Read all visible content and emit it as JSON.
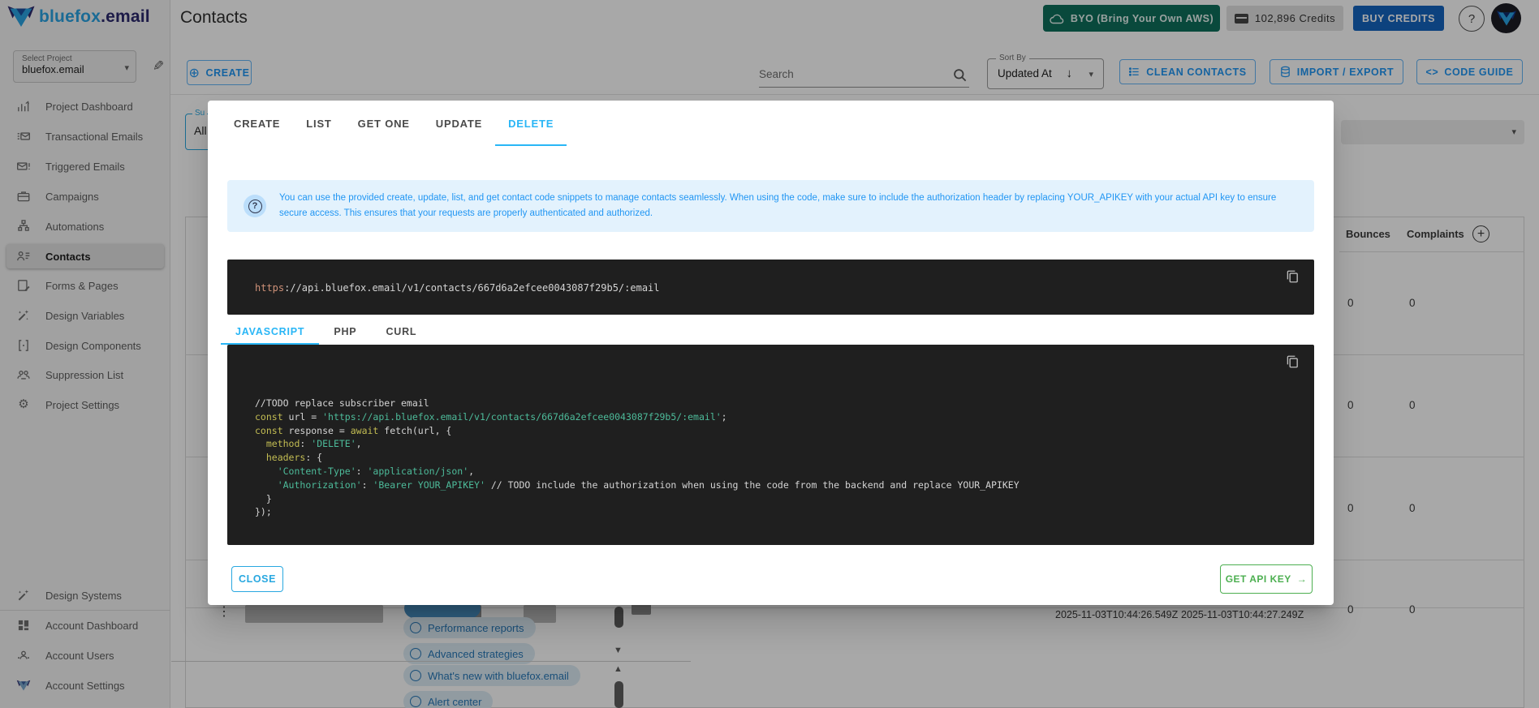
{
  "brand": {
    "word_primary": "bluefox",
    "word_secondary": ".email"
  },
  "topbar": {
    "title": "Contacts",
    "byo_label": "BYO (Bring Your Own AWS)",
    "credits_label": "102,896 Credits",
    "buy_credits_label": "BUY CREDITS",
    "help_label": "?"
  },
  "project_select": {
    "label": "Select Project",
    "value": "bluefox.email"
  },
  "sidebar": {
    "items": [
      {
        "label": "Project Dashboard",
        "icon": "dashboard-icon",
        "active": false
      },
      {
        "label": "Transactional Emails",
        "icon": "transactional-emails-icon",
        "active": false
      },
      {
        "label": "Triggered Emails",
        "icon": "triggered-emails-icon",
        "active": false
      },
      {
        "label": "Campaigns",
        "icon": "campaigns-icon",
        "active": false
      },
      {
        "label": "Automations",
        "icon": "automations-icon",
        "active": false
      },
      {
        "label": "Contacts",
        "icon": "contacts-icon",
        "active": true
      },
      {
        "label": "Forms & Pages",
        "icon": "forms-pages-icon",
        "active": false
      },
      {
        "label": "Design Variables",
        "icon": "design-variables-icon",
        "active": false
      },
      {
        "label": "Design Components",
        "icon": "design-components-icon",
        "active": false
      },
      {
        "label": "Suppression List",
        "icon": "suppression-list-icon",
        "active": false
      },
      {
        "label": "Project Settings",
        "icon": "project-settings-icon",
        "active": false
      }
    ],
    "bottom_items": [
      {
        "label": "Design Systems",
        "icon": "design-systems-icon"
      },
      {
        "label": "Account Dashboard",
        "icon": "account-dashboard-icon"
      },
      {
        "label": "Account Users",
        "icon": "account-users-icon"
      },
      {
        "label": "Account Settings",
        "icon": "account-settings-icon"
      }
    ]
  },
  "toolbar": {
    "create_label": "CREATE",
    "search_placeholder": "Search",
    "sort_label": "Sort By",
    "sort_value": "Updated At",
    "clean_label": "CLEAN CONTACTS",
    "import_export_label": "IMPORT / EXPORT",
    "code_guide_label": "CODE GUIDE"
  },
  "background": {
    "left_filter": {
      "label": "Su",
      "value": "All"
    },
    "table": {
      "headers": [
        "Bounces",
        "Complaints"
      ],
      "zero_rows": [
        [
          "0",
          "0"
        ],
        [
          "0",
          "0"
        ],
        [
          "0",
          "0"
        ],
        [
          "0",
          "0"
        ]
      ],
      "dates": [
        "2025-11-03T10:44:26.549Z",
        "2025-11-03T10:44:27.249Z"
      ]
    },
    "dropdown_chips": [
      "Performance reports",
      "Advanced strategies",
      "What's new with bluefox.email",
      "Alert center"
    ]
  },
  "modal": {
    "tabs": [
      "CREATE",
      "LIST",
      "GET ONE",
      "UPDATE",
      "DELETE"
    ],
    "active_tab": "DELETE",
    "info_text": "You can use the provided create, update, list, and get contact code snippets to manage contacts seamlessly. When using the code, make sure to include the authorization header by replacing YOUR_APIKEY with your actual API key to ensure secure access. This ensures that your requests are properly authenticated and authorized.",
    "endpoint": {
      "scheme": "https",
      "rest": "://api.bluefox.email/v1/contacts/667d6a2efcee0043087f29b5/:email"
    },
    "lang_tabs": [
      "JAVASCRIPT",
      "PHP",
      "CURL"
    ],
    "active_lang": "JAVASCRIPT",
    "code_lines": [
      [
        [
          "p",
          "//TODO replace subscriber email"
        ]
      ],
      [
        [
          "k",
          "const"
        ],
        [
          "p",
          " url = "
        ],
        [
          "s",
          "'https://api.bluefox.email/v1/contacts/667d6a2efcee0043087f29b5/:email'"
        ],
        [
          "p",
          ";"
        ]
      ],
      [
        [
          "k",
          "const"
        ],
        [
          "p",
          " response = "
        ],
        [
          "k",
          "await"
        ],
        [
          "p",
          " fetch(url, {"
        ]
      ],
      [
        [
          "p",
          "  "
        ],
        [
          "k",
          "method"
        ],
        [
          "p",
          ": "
        ],
        [
          "s",
          "'DELETE'"
        ],
        [
          "p",
          ","
        ]
      ],
      [
        [
          "p",
          "  "
        ],
        [
          "k",
          "headers"
        ],
        [
          "p",
          ": {"
        ]
      ],
      [
        [
          "p",
          "    "
        ],
        [
          "s",
          "'Content-Type'"
        ],
        [
          "p",
          ": "
        ],
        [
          "s",
          "'application/json'"
        ],
        [
          "p",
          ","
        ]
      ],
      [
        [
          "p",
          "    "
        ],
        [
          "s",
          "'Authorization'"
        ],
        [
          "p",
          ": "
        ],
        [
          "s",
          "'Bearer YOUR_APIKEY'"
        ],
        [
          "p",
          " // TODO include the authorization when using the code from the backend and replace YOUR_APIKEY"
        ]
      ],
      [
        [
          "p",
          "  }"
        ]
      ],
      [
        [
          "p",
          "});"
        ]
      ]
    ],
    "close_label": "CLOSE",
    "get_api_key_label": "GET API KEY"
  },
  "colors": {
    "accent_cyan": "#29b6f6",
    "toolbar_blue": "#2196f3",
    "byo_teal": "#0e6f5c",
    "buy_blue": "#1565c0",
    "get_key_green": "#4caf50",
    "code_bg": "#1f1f1f",
    "code_keyword": "#c3bd53",
    "code_string": "#4dbb9a",
    "code_plain": "#d4d4d4",
    "url_scheme": "#ce9178",
    "info_bg": "#e3f2fd",
    "info_text": "#2196f3"
  }
}
